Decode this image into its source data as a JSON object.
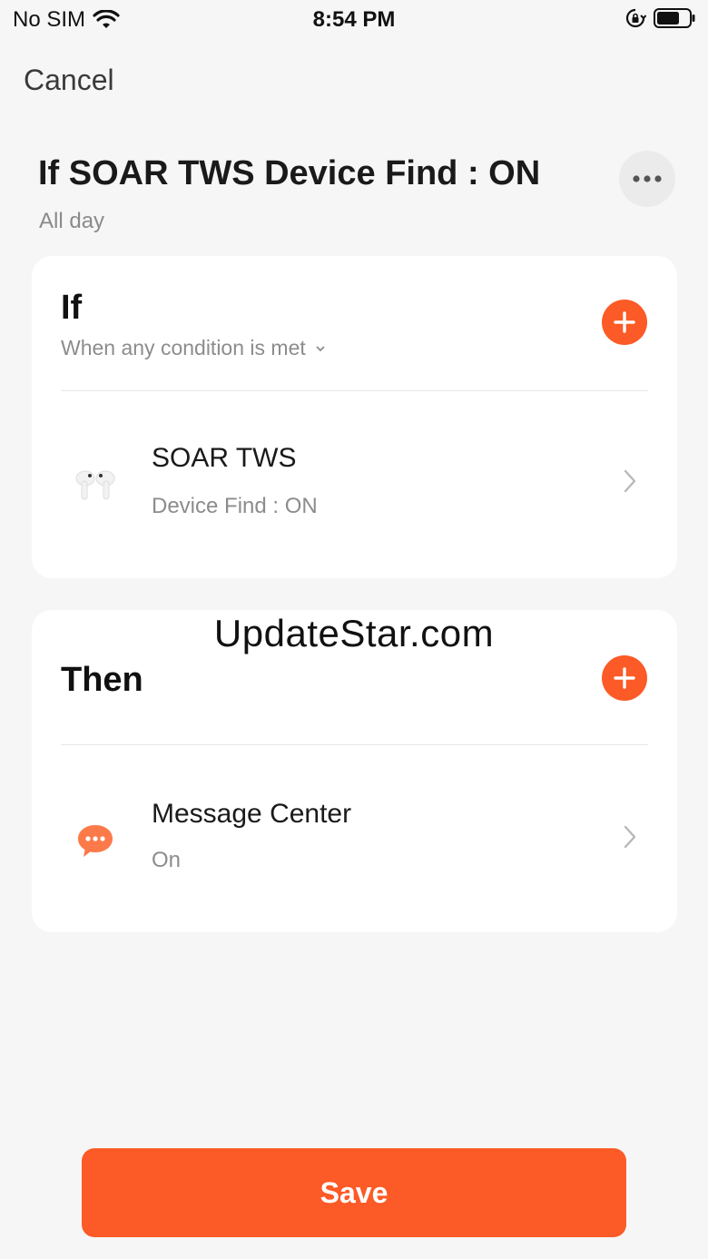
{
  "status_bar": {
    "carrier": "No SIM",
    "time": "8:54 PM",
    "icons": [
      "wifi-icon",
      "rotation-lock-icon",
      "battery-icon"
    ]
  },
  "nav": {
    "cancel_label": "Cancel"
  },
  "header": {
    "title": "If SOAR TWS Device Find : ON",
    "subtitle": "All day",
    "more_icon": "more-horizontal-icon"
  },
  "if_card": {
    "heading": "If",
    "condition_mode": "When any condition is met",
    "items": [
      {
        "title": "SOAR TWS",
        "subtitle": "Device Find : ON",
        "icon": "earbuds-icon"
      }
    ]
  },
  "then_card": {
    "heading": "Then",
    "items": [
      {
        "title": "Message Center",
        "subtitle": "On",
        "icon": "message-bubble-icon"
      }
    ]
  },
  "watermark": "UpdateStar.com",
  "footer": {
    "save_label": "Save"
  },
  "colors": {
    "accent": "#fc5a26",
    "background": "#f6f6f6",
    "card": "#ffffff",
    "muted_text": "#8c8c8c"
  }
}
